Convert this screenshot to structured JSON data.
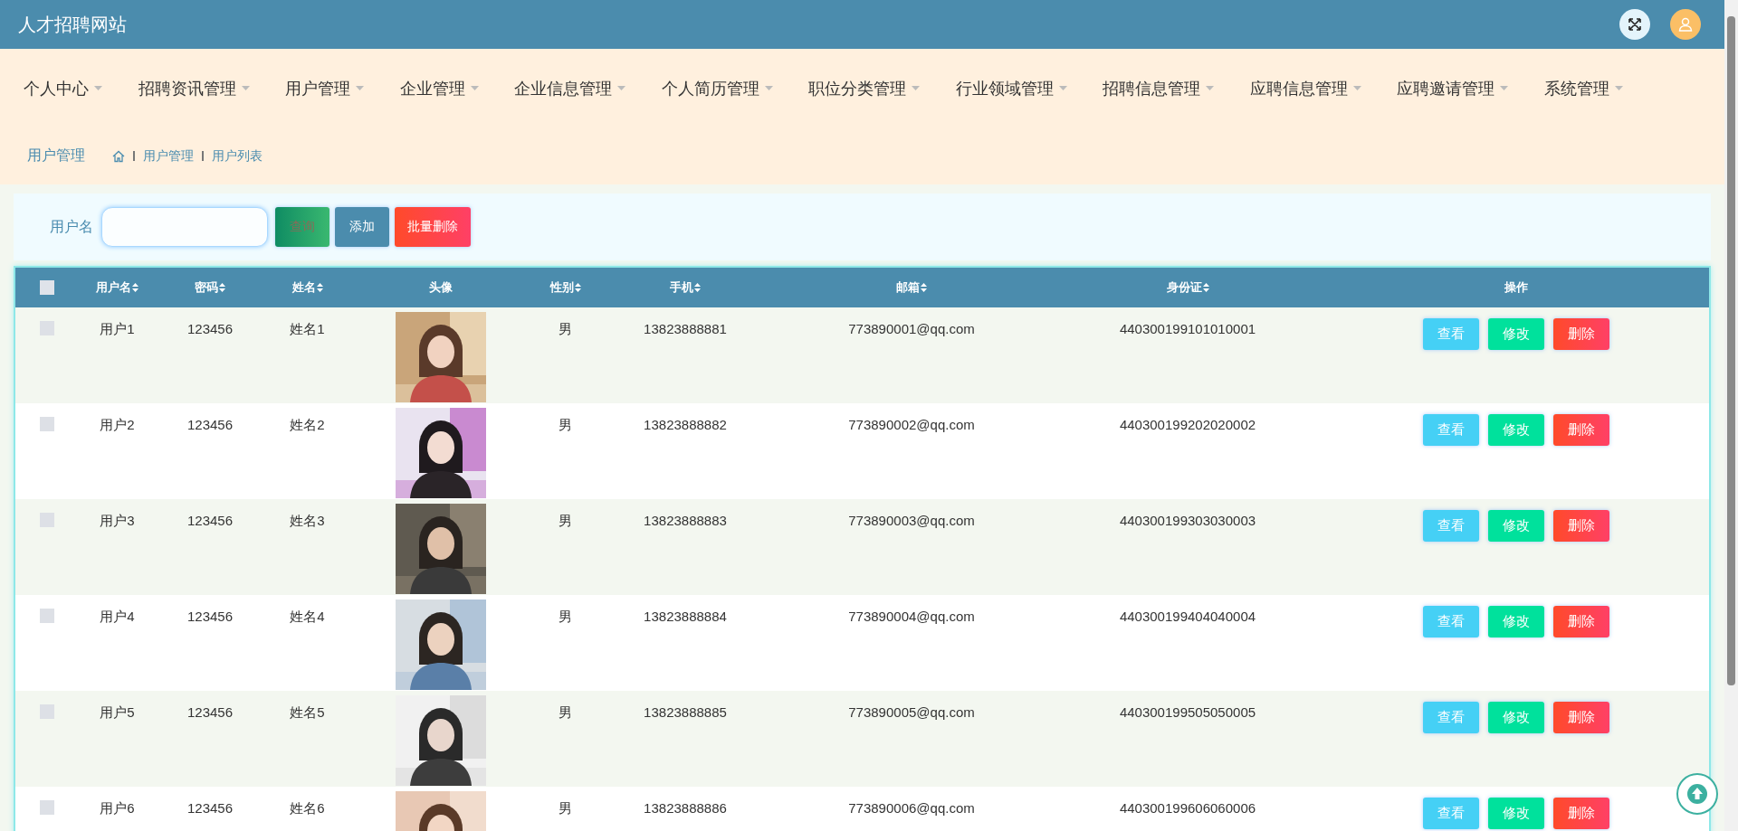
{
  "header": {
    "title": "人才招聘网站"
  },
  "nav": [
    {
      "label": "个人中心"
    },
    {
      "label": "招聘资讯管理"
    },
    {
      "label": "用户管理"
    },
    {
      "label": "企业管理"
    },
    {
      "label": "企业信息管理"
    },
    {
      "label": "个人简历管理"
    },
    {
      "label": "职位分类管理"
    },
    {
      "label": "行业领域管理"
    },
    {
      "label": "招聘信息管理"
    },
    {
      "label": "应聘信息管理"
    },
    {
      "label": "应聘邀请管理"
    },
    {
      "label": "系统管理"
    }
  ],
  "breadcrumb": {
    "title": "用户管理",
    "path": [
      "用户管理",
      "用户列表"
    ]
  },
  "search": {
    "label": "用户名",
    "buttons": [
      {
        "label": "查询",
        "kind": "search"
      },
      {
        "label": "添加",
        "kind": "add"
      },
      {
        "label": "批量删除",
        "kind": "delete"
      }
    ]
  },
  "table": {
    "select_all": {
      "checked": false
    },
    "columns": [
      {
        "label": "用户名",
        "sortable": true
      },
      {
        "label": "密码",
        "sortable": true
      },
      {
        "label": "姓名",
        "sortable": true
      },
      {
        "label": "头像",
        "sortable": false
      },
      {
        "label": "性别",
        "sortable": true
      },
      {
        "label": "手机",
        "sortable": true
      },
      {
        "label": "邮箱",
        "sortable": true
      },
      {
        "label": "身份证",
        "sortable": true
      },
      {
        "label": "操作",
        "sortable": false
      }
    ],
    "rows": [
      {
        "checked": false,
        "username": "用户1",
        "password": "123456",
        "name": "姓名1",
        "sex": "男",
        "phone": "13823888881",
        "email": "773890001@qq.com",
        "id_card": "440300199101010001",
        "actions": [
          {
            "label": "查看",
            "kind": "view"
          },
          {
            "label": "修改",
            "kind": "edit"
          },
          {
            "label": "删除",
            "kind": "delete"
          }
        ]
      },
      {
        "checked": false,
        "username": "用户2",
        "password": "123456",
        "name": "姓名2",
        "sex": "男",
        "phone": "13823888882",
        "email": "773890002@qq.com",
        "id_card": "440300199202020002",
        "actions": [
          {
            "label": "查看",
            "kind": "view"
          },
          {
            "label": "修改",
            "kind": "edit"
          },
          {
            "label": "删除",
            "kind": "delete"
          }
        ]
      },
      {
        "checked": false,
        "username": "用户3",
        "password": "123456",
        "name": "姓名3",
        "sex": "男",
        "phone": "13823888883",
        "email": "773890003@qq.com",
        "id_card": "440300199303030003",
        "actions": [
          {
            "label": "查看",
            "kind": "view"
          },
          {
            "label": "修改",
            "kind": "edit"
          },
          {
            "label": "删除",
            "kind": "delete"
          }
        ]
      },
      {
        "checked": false,
        "username": "用户4",
        "password": "123456",
        "name": "姓名4",
        "sex": "男",
        "phone": "13823888884",
        "email": "773890004@qq.com",
        "id_card": "440300199404040004",
        "actions": [
          {
            "label": "查看",
            "kind": "view"
          },
          {
            "label": "修改",
            "kind": "edit"
          },
          {
            "label": "删除",
            "kind": "delete"
          }
        ]
      },
      {
        "checked": false,
        "username": "用户5",
        "password": "123456",
        "name": "姓名5",
        "sex": "男",
        "phone": "13823888885",
        "email": "773890005@qq.com",
        "id_card": "440300199505050005",
        "actions": [
          {
            "label": "查看",
            "kind": "view"
          },
          {
            "label": "修改",
            "kind": "edit"
          },
          {
            "label": "删除",
            "kind": "delete"
          }
        ]
      },
      {
        "checked": false,
        "username": "用户6",
        "password": "123456",
        "name": "姓名6",
        "sex": "男",
        "phone": "13823888886",
        "email": "773890006@qq.com",
        "id_card": "440300199606060006",
        "actions": [
          {
            "label": "查看",
            "kind": "view"
          },
          {
            "label": "修改",
            "kind": "edit"
          },
          {
            "label": "删除",
            "kind": "delete"
          }
        ]
      }
    ]
  }
}
